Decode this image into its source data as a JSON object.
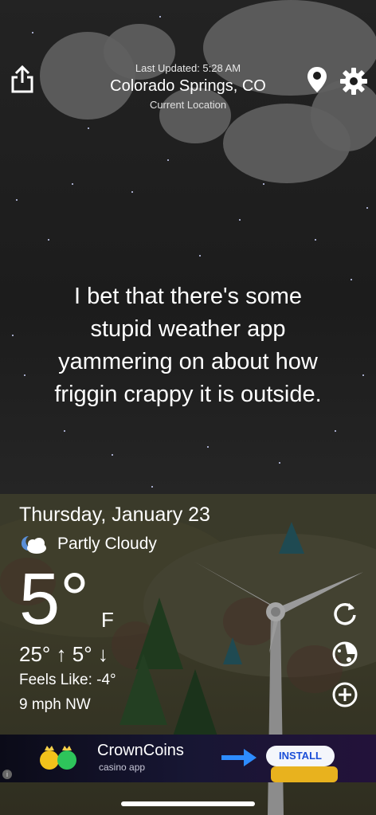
{
  "header": {
    "last_updated": "Last Updated: 5:28 AM",
    "city": "Colorado Springs, CO",
    "location_label": "Current Location"
  },
  "quote": {
    "line1": "I bet that there's some",
    "line2": "stupid weather app",
    "line3": "yammering on about how",
    "line4": "friggin crappy it is outside."
  },
  "weather": {
    "date": "Thursday, January 23",
    "condition": "Partly Cloudy",
    "condition_icon": "partly-cloudy-night-icon",
    "temperature": "5°",
    "unit": "F",
    "hi_lo": "25° ↑  5° ↓",
    "feels_like": "Feels Like: -4°",
    "wind": "9 mph NW"
  },
  "side_buttons": [
    "refresh-icon",
    "radar-icon",
    "add-location-icon"
  ],
  "ad": {
    "info": "i",
    "title": "CrownCoins",
    "subtitle": "casino app",
    "install_label": "INSTALL",
    "accent": "#1b4fd8"
  },
  "colors": {
    "sky": "#1d1d1d",
    "cloud": "#5f5f5f",
    "text": "#ffffff"
  }
}
